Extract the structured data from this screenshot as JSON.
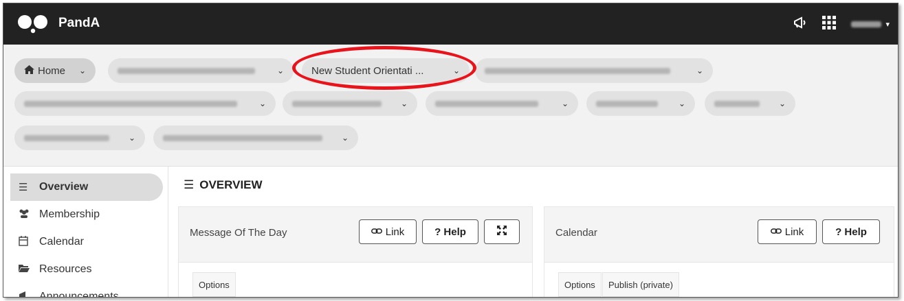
{
  "app": {
    "name": "PandA"
  },
  "topbar": {
    "announce_icon": "megaphone-icon",
    "apps_icon": "grid-icon",
    "user_caret": "▾"
  },
  "site_tabs": {
    "home": "Home",
    "highlighted": "New Student Orientati ..."
  },
  "highlight_color": "#e8141c",
  "sidebar": {
    "items": [
      {
        "label": "Overview",
        "icon": "list-icon"
      },
      {
        "label": "Membership",
        "icon": "users-icon"
      },
      {
        "label": "Calendar",
        "icon": "calendar-icon"
      },
      {
        "label": "Resources",
        "icon": "folder-icon"
      },
      {
        "label": "Announcements",
        "icon": "megaphone-icon"
      }
    ]
  },
  "main": {
    "title": "OVERVIEW",
    "panels": [
      {
        "title": "Message Of The Day",
        "link": "Link",
        "help": "? Help",
        "options": [
          "Options"
        ]
      },
      {
        "title": "Calendar",
        "link": "Link",
        "help": "? Help",
        "options": [
          "Options",
          "Publish (private)"
        ]
      }
    ]
  }
}
